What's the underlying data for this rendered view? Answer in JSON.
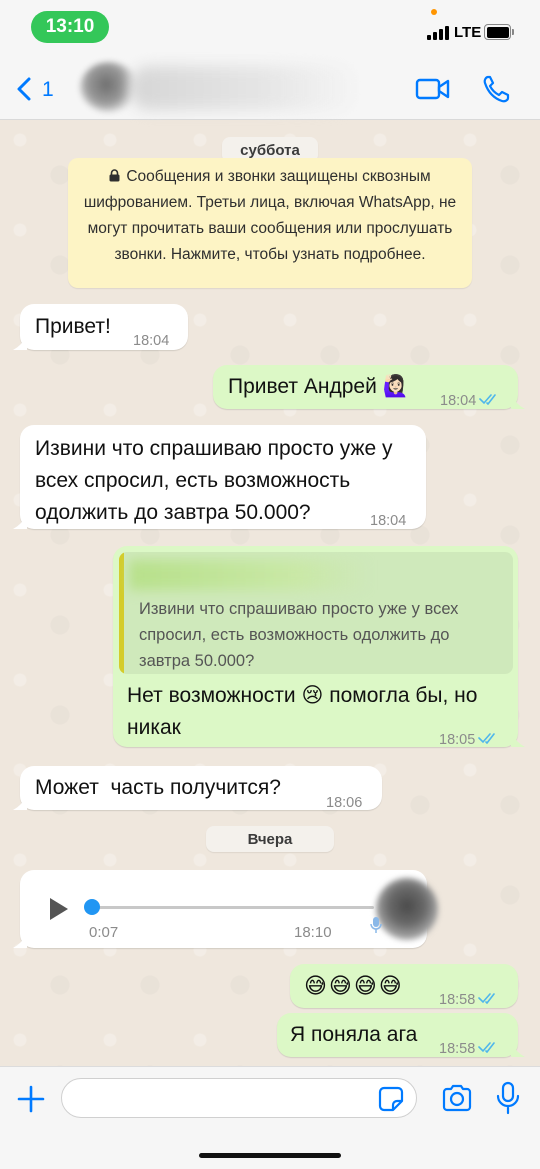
{
  "status_bar": {
    "time": "13:10",
    "network": "LTE"
  },
  "header": {
    "back_count": "1"
  },
  "chat": {
    "date_chips": [
      "суббота",
      "Вчера"
    ],
    "encryption_notice": "Сообщения и звонки защищены сквозным шифрованием. Третьи лица, включая WhatsApp, не могут прочитать ваши сообщения или прослушать звонки. Нажмите, чтобы узнать подробнее.",
    "messages": [
      {
        "direction": "in",
        "text": "Привет!",
        "time": "18:04"
      },
      {
        "direction": "out",
        "text": "Привет Андрей 🙋🏻‍♀️",
        "time": "18:04"
      },
      {
        "direction": "in",
        "text": "Извини что спрашиваю просто уже у всех спросил, есть возможность одолжить до завтра 50.000?",
        "time": "18:04"
      },
      {
        "direction": "out",
        "quote": "Извини что спрашиваю просто уже у всех спросил, есть возможность одолжить до завтра 50.000?",
        "text": "Нет возможности 😢 помогла бы, но никак",
        "time": "18:05"
      },
      {
        "direction": "in",
        "text": "Может  часть получится?",
        "time": "18:06"
      },
      {
        "direction": "in",
        "type": "voice",
        "progress": 0.0,
        "duration": "0:07",
        "time": "18:10"
      },
      {
        "direction": "out",
        "text": "😅😅😅😅",
        "time": "18:58"
      },
      {
        "direction": "out",
        "text": "Я поняла ага",
        "time": "18:58"
      }
    ]
  },
  "composer": {
    "placeholder": ""
  },
  "colors": {
    "accent": "#007aff",
    "outgoing_bubble": "#dcf8c6",
    "incoming_bubble": "#ffffff",
    "read_ticks": "#4fb6ec",
    "time_pill": "#34c759"
  },
  "icons": [
    "back-chevron-icon",
    "video-call-icon",
    "phone-icon",
    "lock-icon",
    "read-ticks-icon",
    "play-icon",
    "mic-icon",
    "plus-icon",
    "sticker-icon",
    "camera-icon"
  ]
}
